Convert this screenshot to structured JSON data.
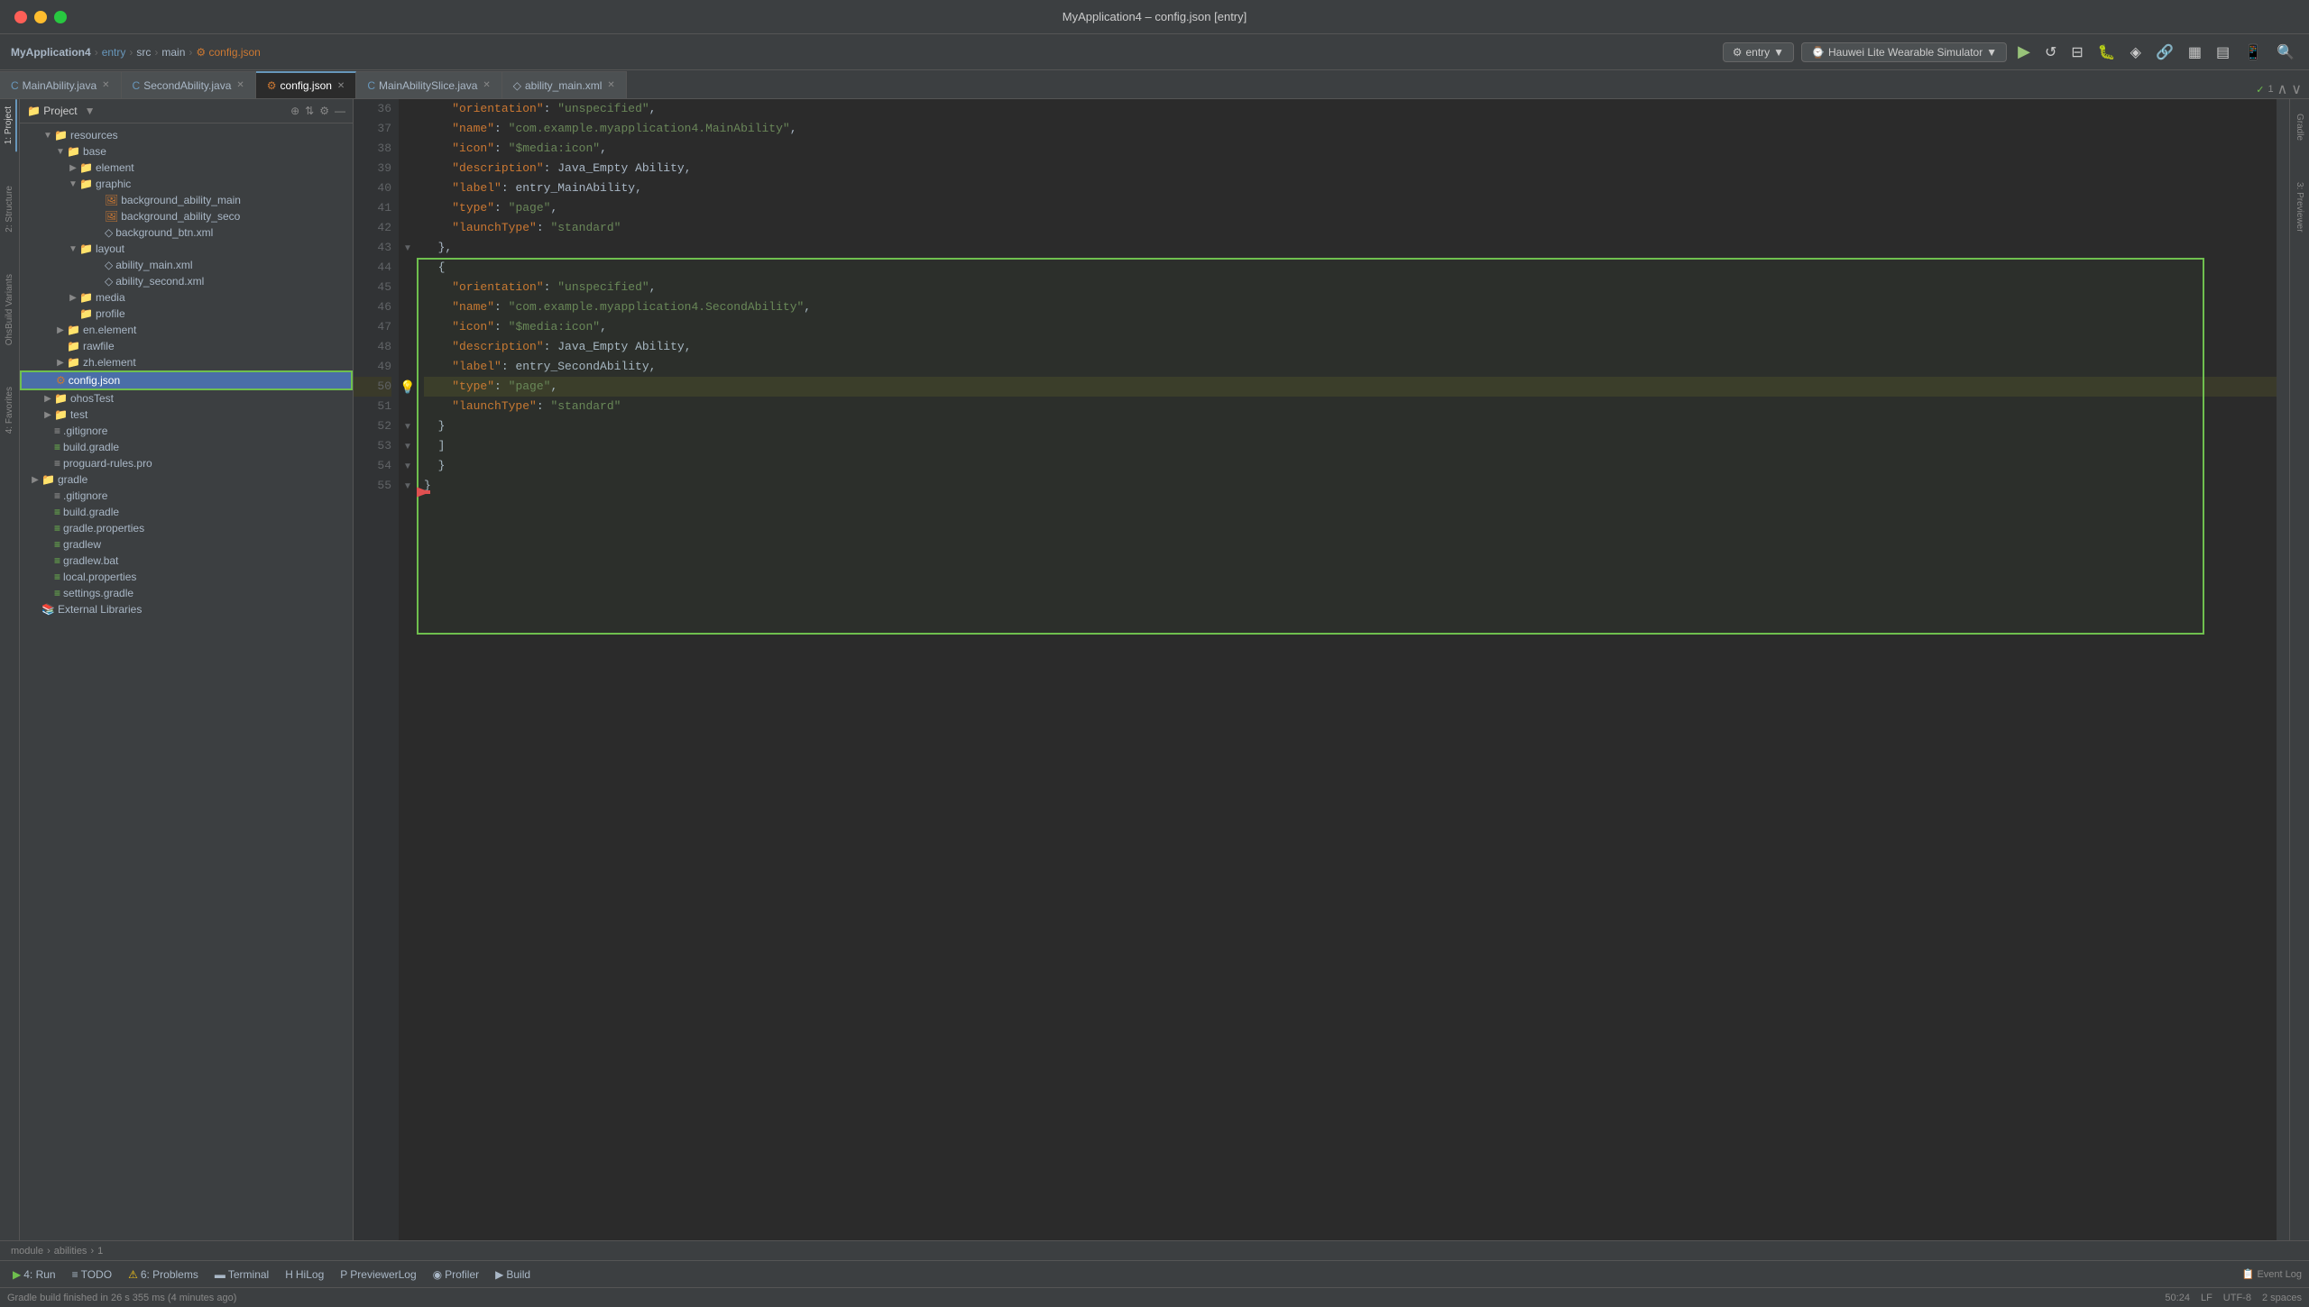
{
  "window": {
    "title": "MyApplication4 – config.json [entry]"
  },
  "titlebar": {
    "dots": [
      "red",
      "yellow",
      "green"
    ]
  },
  "toolbar": {
    "breadcrumb": [
      "MyApplication4",
      "entry",
      "src",
      "main",
      "config.json"
    ],
    "entry_btn": "entry",
    "simulator_btn": "Hauwei Lite Wearable Simulator"
  },
  "tabs": [
    {
      "label": "MainAbility.java",
      "active": false,
      "type": "java"
    },
    {
      "label": "SecondAbility.java",
      "active": false,
      "type": "java"
    },
    {
      "label": "config.json",
      "active": true,
      "type": "json"
    },
    {
      "label": "MainAbilitySlice.java",
      "active": false,
      "type": "java"
    },
    {
      "label": "ability_main.xml",
      "active": false,
      "type": "xml"
    }
  ],
  "file_tree": {
    "header": "Project",
    "items": [
      {
        "indent": 2,
        "type": "folder",
        "name": "resources",
        "expanded": true
      },
      {
        "indent": 3,
        "type": "folder",
        "name": "base",
        "expanded": true
      },
      {
        "indent": 4,
        "type": "folder",
        "name": "element",
        "expanded": false,
        "has_arrow": true
      },
      {
        "indent": 4,
        "type": "folder",
        "name": "graphic",
        "expanded": true
      },
      {
        "indent": 5,
        "type": "img",
        "name": "background_ability_main"
      },
      {
        "indent": 5,
        "type": "img",
        "name": "background_ability_seco"
      },
      {
        "indent": 5,
        "type": "xml",
        "name": "background_btn.xml"
      },
      {
        "indent": 4,
        "type": "folder",
        "name": "layout",
        "expanded": true
      },
      {
        "indent": 5,
        "type": "xml",
        "name": "ability_main.xml"
      },
      {
        "indent": 5,
        "type": "xml",
        "name": "ability_second.xml"
      },
      {
        "indent": 4,
        "type": "folder",
        "name": "media",
        "expanded": false,
        "has_arrow": true
      },
      {
        "indent": 4,
        "type": "folder",
        "name": "profile",
        "expanded": false
      },
      {
        "indent": 3,
        "type": "folder",
        "name": "en.element",
        "expanded": false,
        "has_arrow": true
      },
      {
        "indent": 3,
        "type": "folder",
        "name": "rawfile",
        "expanded": false
      },
      {
        "indent": 3,
        "type": "folder",
        "name": "zh.element",
        "expanded": false,
        "has_arrow": true
      },
      {
        "indent": 2,
        "type": "json-selected",
        "name": "config.json",
        "selected": true
      },
      {
        "indent": 2,
        "type": "folder",
        "name": "ohosTest",
        "expanded": false,
        "has_arrow": true
      },
      {
        "indent": 2,
        "type": "folder",
        "name": "test",
        "expanded": false,
        "has_arrow": true
      },
      {
        "indent": 2,
        "type": "git",
        "name": ".gitignore"
      },
      {
        "indent": 2,
        "type": "gradle",
        "name": "build.gradle"
      },
      {
        "indent": 2,
        "type": "generic",
        "name": "proguard-rules.pro"
      },
      {
        "indent": 1,
        "type": "folder",
        "name": "gradle",
        "expanded": false,
        "has_arrow": true
      },
      {
        "indent": 2,
        "type": "git",
        "name": ".gitignore"
      },
      {
        "indent": 2,
        "type": "gradle",
        "name": "build.gradle"
      },
      {
        "indent": 2,
        "type": "gradle",
        "name": "gradle.properties"
      },
      {
        "indent": 2,
        "type": "gradle",
        "name": "gradlew"
      },
      {
        "indent": 2,
        "type": "gradle",
        "name": "gradlew.bat"
      },
      {
        "indent": 2,
        "type": "gradle",
        "name": "local.properties"
      },
      {
        "indent": 2,
        "type": "gradle",
        "name": "settings.gradle"
      },
      {
        "indent": 1,
        "type": "folder",
        "name": "External Libraries",
        "expanded": false
      }
    ]
  },
  "editor": {
    "lines": [
      {
        "num": 36,
        "content": "  \"orientation\": \"unspecified\",",
        "tokens": [
          {
            "t": "key",
            "v": "\"orientation\""
          },
          {
            "t": "val",
            "v": ": "
          },
          {
            "t": "str",
            "v": "\"unspecified\""
          },
          {
            "t": "val",
            "v": ","
          }
        ]
      },
      {
        "num": 37,
        "content": "  \"name\": \"com.example.myapplication4.MainAbility\","
      },
      {
        "num": 38,
        "content": "  \"icon\": \"$media:icon\","
      },
      {
        "num": 39,
        "content": "  \"description\": Java_Empty Ability,"
      },
      {
        "num": 40,
        "content": "  \"label\": entry_MainAbility,"
      },
      {
        "num": 41,
        "content": "  \"type\": \"page\","
      },
      {
        "num": 42,
        "content": "  \"launchType\": \"standard\""
      },
      {
        "num": 43,
        "content": "},"
      },
      {
        "num": 44,
        "content": "{"
      },
      {
        "num": 45,
        "content": "  \"orientation\": \"unspecified\","
      },
      {
        "num": 46,
        "content": "  \"name\": \"com.example.myapplication4.SecondAbility\","
      },
      {
        "num": 47,
        "content": "  \"icon\": \"$media:icon\","
      },
      {
        "num": 48,
        "content": "  \"description\": Java_Empty Ability,"
      },
      {
        "num": 49,
        "content": "  \"label\": entry_SecondAbility,"
      },
      {
        "num": 50,
        "content": "  \"type\": \"page\","
      },
      {
        "num": 51,
        "content": "  \"launchType\": \"standard\""
      },
      {
        "num": 52,
        "content": "}"
      },
      {
        "num": 53,
        "content": "]"
      },
      {
        "num": 54,
        "content": "}"
      },
      {
        "num": 55,
        "content": "}"
      }
    ]
  },
  "breadcrumb_bottom": {
    "items": [
      "module",
      "abilities",
      "1"
    ]
  },
  "bottom_toolbar": {
    "items": [
      {
        "icon": "▶",
        "label": "4: Run"
      },
      {
        "icon": "≡",
        "label": "TODO"
      },
      {
        "icon": "⚠",
        "label": "6: Problems"
      },
      {
        "icon": "▬",
        "label": "Terminal"
      },
      {
        "icon": "H",
        "label": "HiLog"
      },
      {
        "icon": "P",
        "label": "PreviewerLog"
      },
      {
        "icon": "◉",
        "label": "Profiler"
      },
      {
        "icon": "▶",
        "label": "Build"
      }
    ],
    "right": {
      "event_log": "Event Log"
    }
  },
  "status_bar": {
    "message": "Gradle build finished in 26 s 355 ms (4 minutes ago)",
    "right": {
      "position": "50:24",
      "line_sep": "LF",
      "encoding": "UTF-8",
      "indent": "2 spaces"
    }
  },
  "left_panels": [
    {
      "label": "1: Project",
      "active": true
    },
    {
      "label": "2: Structure"
    },
    {
      "label": "4: Favorites"
    }
  ],
  "right_panels": [
    {
      "label": "Gradle"
    },
    {
      "label": "3: Previewer"
    }
  ]
}
